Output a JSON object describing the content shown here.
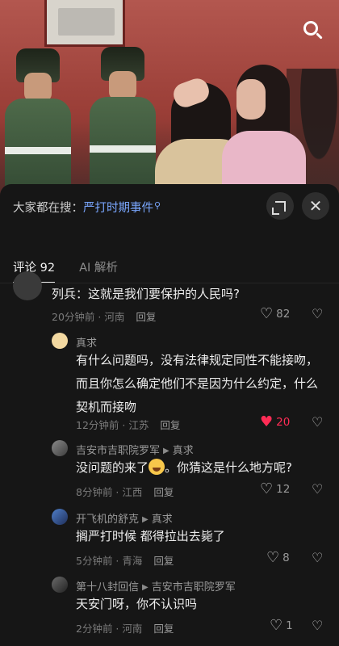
{
  "search": {
    "icon": "search-icon"
  },
  "hot_search": {
    "prefix": "大家都在搜：",
    "keyword": "严打时期事件",
    "icon": "search-mini-icon"
  },
  "controls": {
    "expand_icon": "expand-icon",
    "close_label": "✕"
  },
  "tabs": [
    {
      "label": "评论 92",
      "active": true
    },
    {
      "label": "AI 解析",
      "active": false
    }
  ],
  "comments": [
    {
      "name": "列兵",
      "text": "这就是我们要保护的人民吗?",
      "time": "20分钟前 · 河南",
      "reply": "回复",
      "likes": "82",
      "liked": false
    },
    {
      "name": "真求",
      "text": "有什么问题吗，没有法律规定同性不能接吻，而且你怎么确定他们不是因为什么约定，什么契机而接吻",
      "time": "12分钟前 · 江苏",
      "reply": "回复",
      "likes": "20",
      "liked": true
    },
    {
      "name": "吉安市吉职院罗军",
      "reply_to": "真求",
      "text_before": "没问题的来了",
      "text_after": "。你猜这是什么地方呢?",
      "time": "8分钟前 · 江西",
      "reply": "回复",
      "likes": "12",
      "liked": false
    },
    {
      "name": "开飞机的舒克",
      "reply_to": "真求",
      "text": "搁严打时候 都得拉出去毙了",
      "time": "5分钟前 · 青海",
      "reply": "回复",
      "likes": "8",
      "liked": false
    },
    {
      "name": "第十八封回信",
      "reply_to": "吉安市吉职院罗军",
      "text": "天安门呀，你不认识吗",
      "time": "2分钟前 · 河南",
      "reply": "回复",
      "likes": "1",
      "liked": false
    }
  ],
  "colors": {
    "accent": "#fe2c55",
    "link": "#7aa7ff",
    "background": "#161616"
  }
}
